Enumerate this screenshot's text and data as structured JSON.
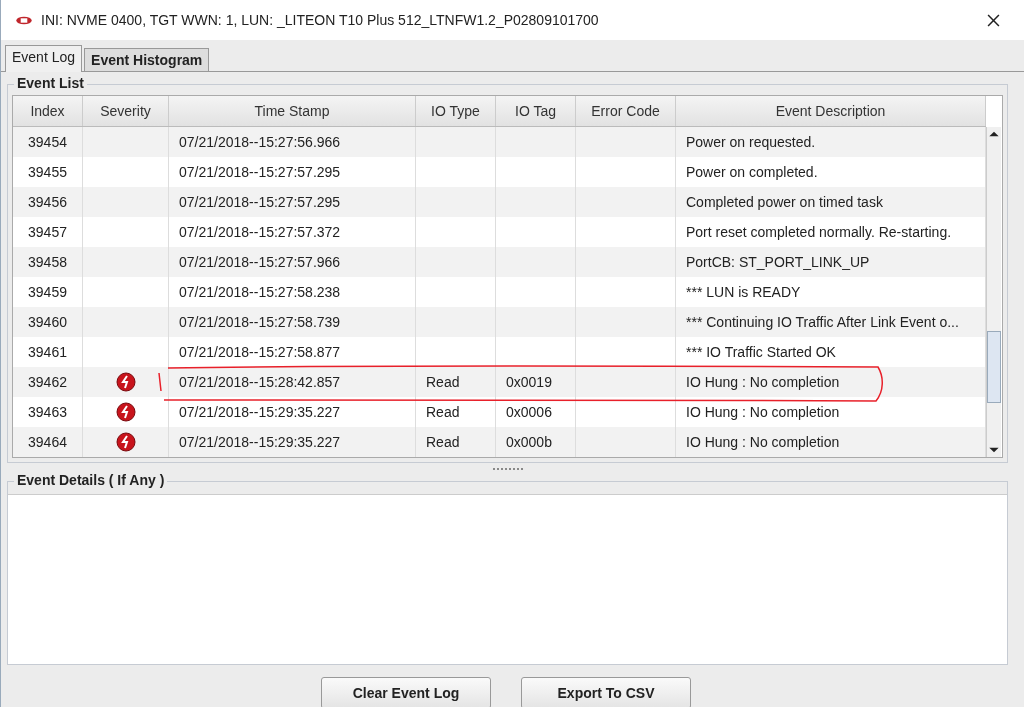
{
  "window": {
    "title": "INI: NVME 0400, TGT WWN: 1, LUN: _LITEON T10 Plus 512_LTNFW1.2_P02809101700"
  },
  "tabs": [
    {
      "label": "Event Log",
      "selected": true
    },
    {
      "label": "Event Histogram",
      "selected": false
    }
  ],
  "event_list": {
    "title": "Event List",
    "columns": [
      "Index",
      "Severity",
      "Time Stamp",
      "IO Type",
      "IO Tag",
      "Error Code",
      "Event Description"
    ],
    "rows": [
      {
        "index": "39454",
        "error": false,
        "time": "07/21/2018--15:27:56.966",
        "io_type": "",
        "io_tag": "",
        "error_code": "",
        "description": "Power on requested."
      },
      {
        "index": "39455",
        "error": false,
        "time": "07/21/2018--15:27:57.295",
        "io_type": "",
        "io_tag": "",
        "error_code": "",
        "description": "Power on completed."
      },
      {
        "index": "39456",
        "error": false,
        "time": "07/21/2018--15:27:57.295",
        "io_type": "",
        "io_tag": "",
        "error_code": "",
        "description": "Completed power on timed task"
      },
      {
        "index": "39457",
        "error": false,
        "time": "07/21/2018--15:27:57.372",
        "io_type": "",
        "io_tag": "",
        "error_code": "",
        "description": "Port reset completed normally. Re-starting."
      },
      {
        "index": "39458",
        "error": false,
        "time": "07/21/2018--15:27:57.966",
        "io_type": "",
        "io_tag": "",
        "error_code": "",
        "description": "PortCB:   ST_PORT_LINK_UP"
      },
      {
        "index": "39459",
        "error": false,
        "time": "07/21/2018--15:27:58.238",
        "io_type": "",
        "io_tag": "",
        "error_code": "",
        "description": "*** LUN is READY"
      },
      {
        "index": "39460",
        "error": false,
        "time": "07/21/2018--15:27:58.739",
        "io_type": "",
        "io_tag": "",
        "error_code": "",
        "description": "*** Continuing IO Traffic After Link Event o..."
      },
      {
        "index": "39461",
        "error": false,
        "time": "07/21/2018--15:27:58.877",
        "io_type": "",
        "io_tag": "",
        "error_code": "",
        "description": "*** IO Traffic Started OK"
      },
      {
        "index": "39462",
        "error": true,
        "time": "07/21/2018--15:28:42.857",
        "io_type": "Read",
        "io_tag": "0x0019",
        "error_code": "",
        "description": "IO Hung : No completion"
      },
      {
        "index": "39463",
        "error": true,
        "time": "07/21/2018--15:29:35.227",
        "io_type": "Read",
        "io_tag": "0x0006",
        "error_code": "",
        "description": "IO Hung : No completion"
      },
      {
        "index": "39464",
        "error": true,
        "time": "07/21/2018--15:29:35.227",
        "io_type": "Read",
        "io_tag": "0x000b",
        "error_code": "",
        "description": "IO Hung : No completion"
      }
    ]
  },
  "event_details": {
    "title": "Event Details ( If Any )"
  },
  "buttons": [
    "Clear Event Log",
    "Export To CSV"
  ]
}
